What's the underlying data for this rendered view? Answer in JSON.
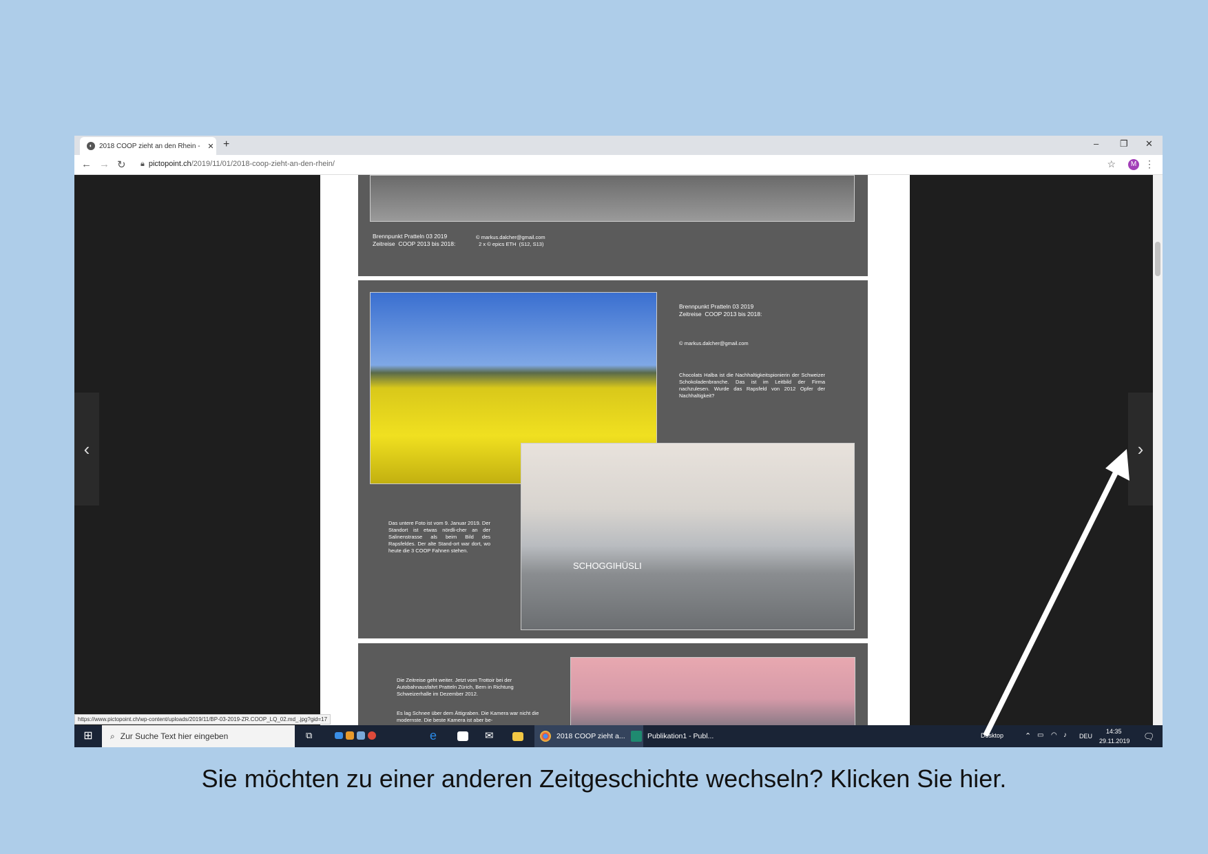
{
  "browser": {
    "tab_title": "2018 COOP zieht an den Rhein -",
    "tab_close": "✕",
    "new_tab": "+",
    "url_host": "pictopoint.ch",
    "url_path": "/2019/11/01/2018-coop-zieht-an-den-rhein/",
    "profile_initial": "M",
    "status_url": "https://www.pictopoint.ch/wp-content/uploads/2019/11/BP-03-2019-ZR.COOP_LQ_02.md_.jpg?gid=17"
  },
  "article": {
    "top_caption_left": "Brennpunkt Pratteln 03 2019\nZeitreise  COOP 2013 bis 2018:",
    "top_caption_right": "© markus.dalcher@gmail.com\n  2 x © epics ETH  (S12, S13)",
    "panel2_title": "Brennpunkt Pratteln 03 2019\nZeitreise  COOP 2013 bis 2018:",
    "panel2_credit": "© markus.dalcher@gmail.com",
    "panel2_text": "Chocolats Halba ist die Nachhaltigkeitspionierin der Schweizer Schokoladenbranche. Das ist im Leitbild der Firma nachzulesen.  Wurde das Rapsfeld von 2012 Opfer der Nachhaltigkeit?",
    "panel2_text2": "Das untere Foto ist vom 9. Januar 2019. Der Standort ist etwas nördli-cher an der Salinenstrasse als beim Bild des Rapsfeldes. Der alte Stand-ort war dort, wo heute die 3 COOP Fahnen stehen.",
    "building_sign": "SCHOGGIHÜSLI",
    "panel3_text": "Die Zeitreise geht weiter. Jetzt vom Trottoir bei der Autobahnausfahrt Pratteln  Zürich, Bern in Richtung Schweizerhalle im Dezember 2012.",
    "panel3_text2": "Es lag Schnee über dem Ättigraben. Die Kamera war nicht die modernste. Die beste Kamera ist  aber be-"
  },
  "taskbar": {
    "search_placeholder": "Zur Suche Text hier eingeben",
    "app1": "2018 COOP zieht a...",
    "app2": "Publikation1 - Publ...",
    "desktop": "Desktop",
    "lang": "DEU",
    "time": "14:35",
    "date": "29.11.2019"
  },
  "caption": "Sie möchten zu einer anderen Zeitgeschichte wechseln? Klicken Sie hier."
}
